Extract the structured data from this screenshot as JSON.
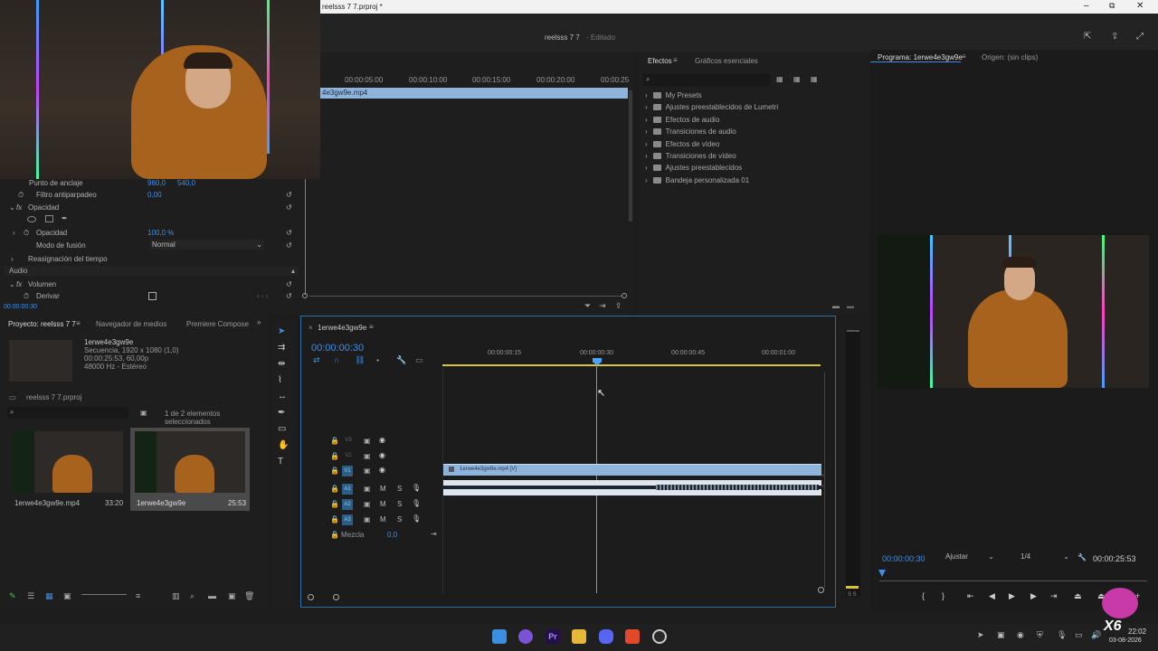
{
  "window": {
    "title": "reelsss 7 7.prproj *",
    "project_title": "reelsss 7 7",
    "edited": "- Editado"
  },
  "source_monitor": {
    "ruler": [
      "00:00:05:00",
      "00:00:10:00",
      "00:00:15:00",
      "00:00:20:00",
      "00:00:25"
    ],
    "clip_name": "4e3gw9e.mp4"
  },
  "effect_controls": {
    "rows": [
      {
        "label": "Punto de anclaje",
        "values": [
          "960,0",
          "540,0"
        ]
      },
      {
        "label": "Filtro antiparpadeo",
        "values": [
          "0,00"
        ]
      },
      {
        "label": "Opacidad",
        "section": true
      },
      {
        "label": "Opacidad",
        "values": [
          "100,0 %"
        ]
      },
      {
        "label": "Modo de fusión",
        "dropdown": "Normal"
      },
      {
        "label": "Reasignación del tiempo",
        "section": true
      },
      {
        "label": "Audio",
        "header": true
      },
      {
        "label": "Volumen",
        "section": true
      },
      {
        "label": "Derivar",
        "checkbox": true
      }
    ],
    "timecode": "00:00:00:30"
  },
  "effects_panel": {
    "tabs": [
      "Efectos",
      "Gráficos esenciales"
    ],
    "tree": [
      "My Presets",
      "Ajustes preestablecidos de Lumetri",
      "Efectos de audio",
      "Transiciones de audio",
      "Efectos de vídeo",
      "Transiciones de vídeo",
      "Ajustes preestablecidos",
      "Bandeja personalizada 01"
    ]
  },
  "program_monitor": {
    "tabs": [
      "Programa: 1erwe4e3gw9e",
      "Origen: (sin clips)"
    ],
    "timecode": "00:00:00:30",
    "fit": "Ajustar",
    "quality": "1/4",
    "duration": "00:00:25:53"
  },
  "project_panel": {
    "tabs": [
      "Proyecto: reelsss 7 7",
      "Navegador de medios",
      "Premiere Compose"
    ],
    "info": {
      "name": "1erwe4e3gw9e",
      "line1": "Secuencia, 1920 x 1080 (1,0)",
      "line2": "00:00:25:53, 60,00p",
      "line3": "48000 Hz - Estéreo"
    },
    "folder": "reelsss 7 7.prproj",
    "selection": "1 de 2 elementos seleccionados",
    "items": [
      {
        "name": "1erwe4e3gw9e.mp4",
        "duration": "33:20"
      },
      {
        "name": "1erwe4e3gw9e",
        "duration": "25:53"
      }
    ]
  },
  "timeline": {
    "tab": "1erwe4e3gw9e",
    "timecode": "00:00:00:30",
    "ruler": [
      "00:00:00:15",
      "00:00:00:30",
      "00:00:00:45",
      "00:00:01:00"
    ],
    "video_tracks": [
      "V3",
      "V2",
      "V1"
    ],
    "audio_tracks": [
      "A1",
      "A2",
      "A3"
    ],
    "mix_label": "Mezcla",
    "mix_value": "0,0",
    "clip_label": "1erwe4e3gw9e.mp4 [V]"
  },
  "taskbar": {
    "time": "22:02",
    "date": "03-08-2026"
  },
  "colors": {
    "accent": "#3d8fe6",
    "clip": "#8fb4dc",
    "playhead": "#4aa3ff"
  }
}
